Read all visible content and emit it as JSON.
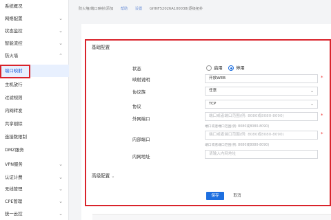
{
  "sidebar": {
    "items": [
      {
        "label": "系统概况"
      },
      {
        "label": "网络配置",
        "chevron": "⌄"
      },
      {
        "label": "状态监控",
        "chevron": "⌄"
      },
      {
        "label": "智能流控",
        "chevron": "⌄"
      },
      {
        "label": "防火墙",
        "chevron": "⌃"
      },
      {
        "label": "端口映射"
      },
      {
        "label": "主机放行"
      },
      {
        "label": "过滤规则"
      },
      {
        "label": "内网转发"
      },
      {
        "label": "共享剔除"
      },
      {
        "label": "连接数限制"
      },
      {
        "label": "DMZ服务"
      },
      {
        "label": "VPN服务",
        "chevron": "⌄"
      },
      {
        "label": "认证计费",
        "chevron": "⌄"
      },
      {
        "label": "无线管理",
        "chevron": "⌄"
      },
      {
        "label": "CPE管理",
        "chevron": "⌄"
      },
      {
        "label": "统一云控",
        "chevron": "⌄"
      }
    ]
  },
  "breadcrumb": {
    "path": "防火墙/端口映射/添加",
    "link1": "帮助",
    "link2": "设置",
    "device": "GHNF52026A100038(逐级拓扑"
  },
  "form": {
    "basic_title": "基础配置",
    "advanced_title": "高级配置",
    "advanced_chevron": "⌄",
    "status_label": "状态",
    "status_on": "启用",
    "status_off": "停用",
    "desc_label": "映射说明",
    "desc_value": "开放WEB",
    "proto_family_label": "协议族",
    "proto_family_value": "任意",
    "protocol_label": "协议",
    "protocol_value": "TCP",
    "ext_port_label": "外网端口",
    "ext_port_placeholder": "端口或者端口范围(例: 8080或8080-8090)",
    "ext_port_hint": "端口或者端口范围(例: 8080或8080-8090)",
    "int_port_label": "内部端口",
    "int_port_placeholder": "端口或者端口范围(例: 8080或8080-8090)",
    "int_port_hint": "端口或者端口范围(例: 8080或8080-8090)",
    "int_addr_label": "内网地址",
    "int_addr_placeholder": "请输入内网地址",
    "required_mark": "*",
    "select_arrow": "⌄",
    "save_label": "保存",
    "cancel_label": "取消"
  },
  "colors": {
    "accent": "#1e6fe0",
    "highlight_border": "#d9232b"
  }
}
